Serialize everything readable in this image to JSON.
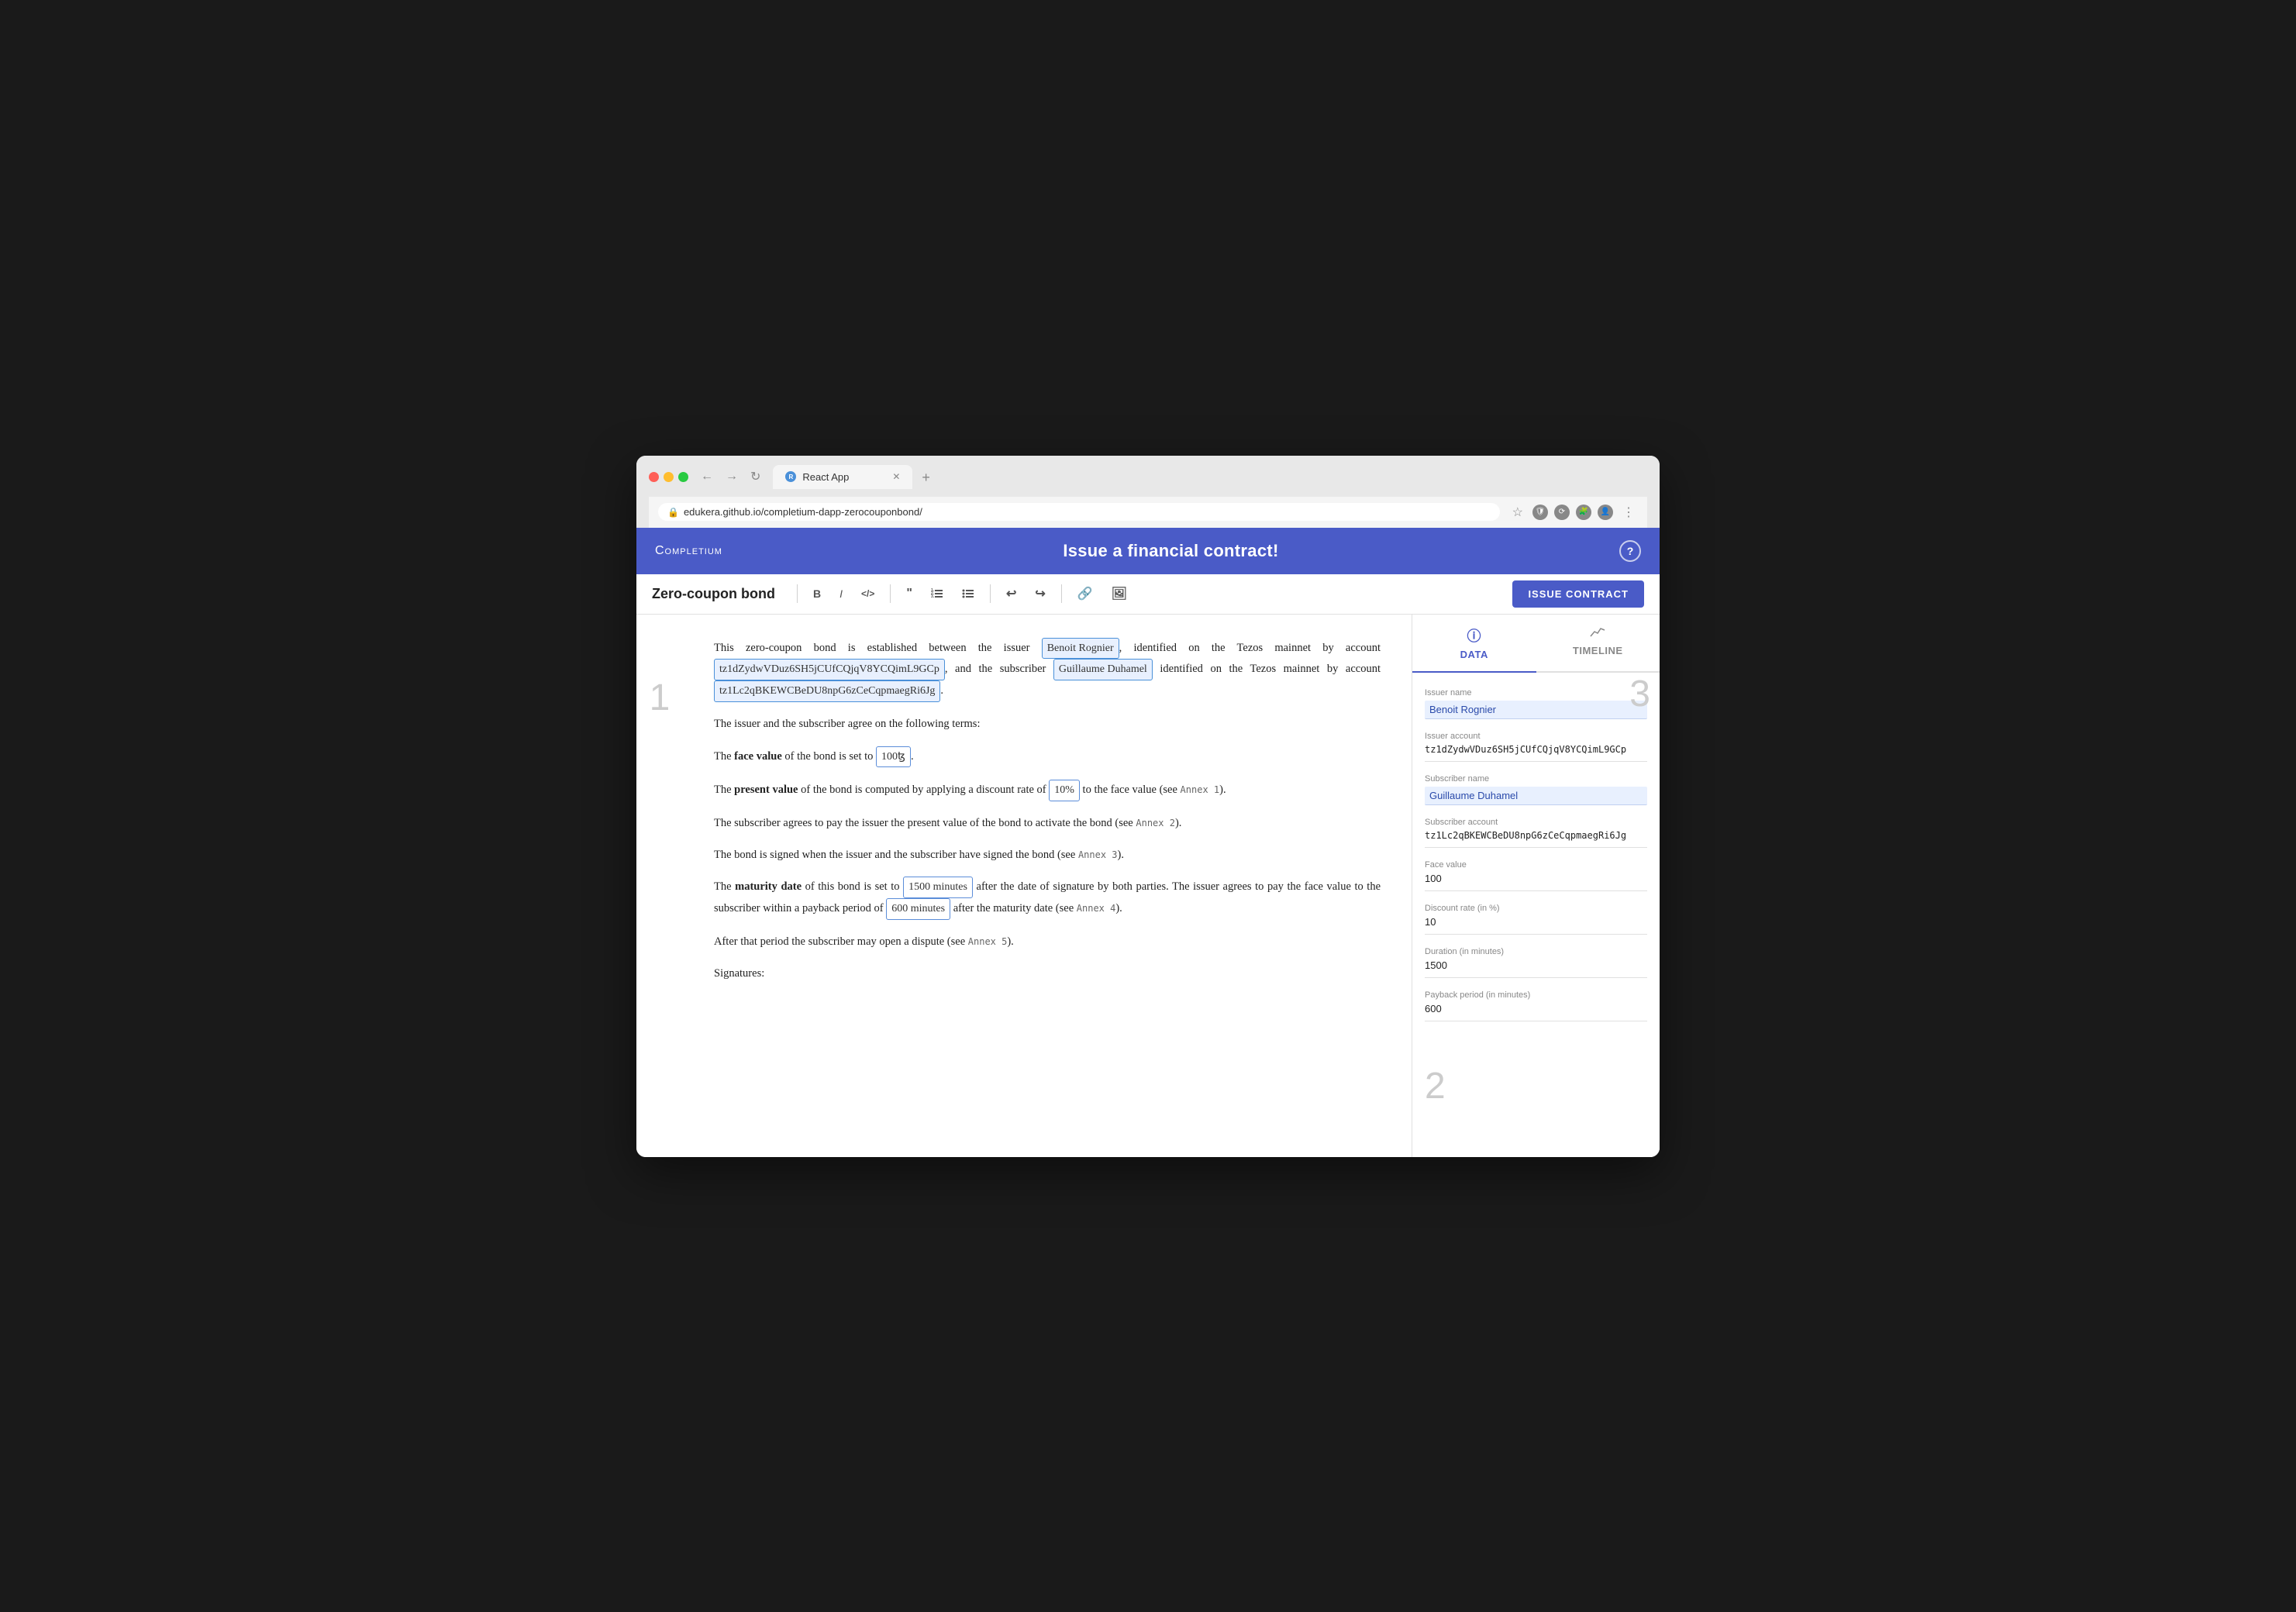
{
  "browser": {
    "tab_label": "React App",
    "address": "edukera.github.io/completium-dapp-zerocouponbond/",
    "new_tab_plus": "+",
    "back": "←",
    "forward": "→",
    "reload": "↻"
  },
  "app": {
    "logo": "Completium",
    "header_title": "Issue a financial contract!",
    "help_label": "?",
    "doc_title": "Zero-coupon bond",
    "issue_contract_btn": "ISSUE CONTRACT"
  },
  "toolbar": {
    "bold": "B",
    "italic": "I",
    "code": "</>",
    "quote": "❝",
    "ordered_list": "≡",
    "unordered_list": "☰",
    "undo": "↩",
    "redo": "↪",
    "link": "🔗",
    "image": "🖼"
  },
  "contract": {
    "intro": "This zero-coupon bond is established between the issuer",
    "issuer_name": "Benoit Rognier",
    "identified_1": ", identified on the Tezos mainnet by account",
    "issuer_account": "tz1dZydwVDuz6SH5jCUfCQjqV8YCQimL9GCp",
    "and_subscriber": ", and the subscriber",
    "subscriber_name": "Guillaume Duhamel",
    "identified_2": "identified on the Tezos mainnet by account",
    "subscriber_account": "tz1Lc2qBKEWCBeDU8npG6zCeCqpmaegRi6Jg",
    "terms_line": "The issuer and the subscriber agree on the following terms:",
    "face_value_intro": "The",
    "face_value_label": "face value",
    "face_value_mid": "of the bond is set to",
    "face_value": "100ꜩ",
    "face_value_end": ".",
    "present_value_intro": "The",
    "present_value_label": "present value",
    "present_value_mid": "of the bond is computed by applying a discount rate of",
    "discount_rate": "10%",
    "present_value_end": "to the face value (see Annex 1).",
    "subscriber_pay": "The subscriber agrees to pay the issuer the present value of the bond to activate the bond (see Annex 2).",
    "bond_signed": "The bond is signed when the issuer and the subscriber have signed the bond (see Annex 3).",
    "maturity_intro": "The",
    "maturity_label": "maturity date",
    "maturity_mid": "of this bond is set to",
    "maturity_duration": "1500 minutes",
    "maturity_after": "after the date of signature by both parties. The issuer agrees to pay the face value to the subscriber within a payback period of",
    "payback_period": "600 minutes",
    "maturity_end": "after the maturity date (see Annex 4).",
    "dispute": "After that period the subscriber may open a dispute (see Annex 5).",
    "signatures": "Signatures:"
  },
  "panel": {
    "data_tab": "DATA",
    "timeline_tab": "TIMELINE",
    "data_icon": "ⓘ",
    "timeline_icon": "📈",
    "fields": [
      {
        "label": "Issuer name",
        "value": "Benoit Rognier",
        "highlighted": true
      },
      {
        "label": "Issuer account",
        "value": "tz1dZydwVDuz6SH5jCUfCQjqV8YCQimL9GCp",
        "highlighted": false
      },
      {
        "label": "Subscriber name",
        "value": "Guillaume Duhamel",
        "highlighted": true
      },
      {
        "label": "Subscriber account",
        "value": "tz1Lc2qBKEWCBeDU8npG6zCeCqpmaegRi6Jg",
        "highlighted": false
      },
      {
        "label": "Face value",
        "value": "100",
        "highlighted": false
      },
      {
        "label": "Discount rate (in %)",
        "value": "10",
        "highlighted": false
      },
      {
        "label": "Duration (in minutes)",
        "value": "1500",
        "highlighted": false
      },
      {
        "label": "Payback period (in minutes)",
        "value": "600",
        "highlighted": false
      }
    ]
  },
  "annotations": {
    "one": "1",
    "two": "2",
    "three": "3"
  }
}
